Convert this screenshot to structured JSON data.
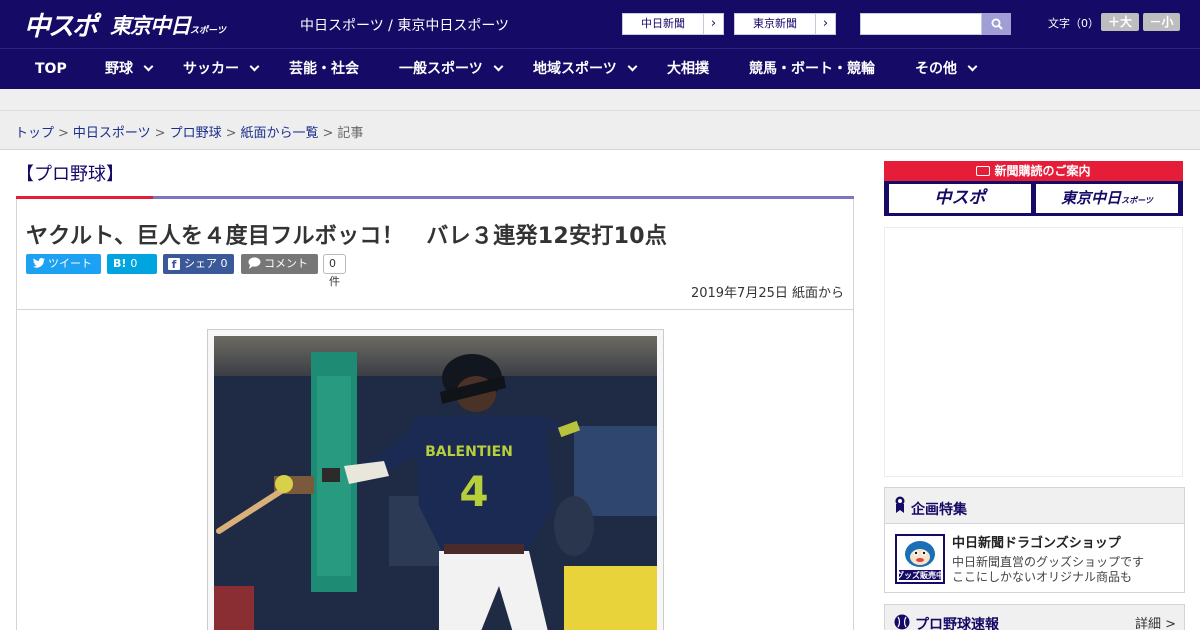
{
  "header": {
    "logo_primary": "中スポ",
    "logo_secondary": "東京中日",
    "logo_secondary_sub": "スポーツ",
    "site_links": "中日スポーツ / 東京中日スポーツ",
    "paper_buttons": [
      {
        "label": "中日新聞",
        "arrow": "›"
      },
      {
        "label": "東京新聞",
        "arrow": "›"
      }
    ],
    "search": {
      "placeholder": "",
      "icon": "search-icon"
    },
    "font_size": {
      "label": "文字（0）",
      "increase": "＋大",
      "decrease": "－小"
    }
  },
  "nav": {
    "items": [
      {
        "label": "TOP",
        "has_dropdown": false
      },
      {
        "label": "野球",
        "has_dropdown": true
      },
      {
        "label": "サッカー",
        "has_dropdown": true
      },
      {
        "label": "芸能・社会",
        "has_dropdown": false
      },
      {
        "label": "一般スポーツ",
        "has_dropdown": true
      },
      {
        "label": "地域スポーツ",
        "has_dropdown": true
      },
      {
        "label": "大相撲",
        "has_dropdown": false
      },
      {
        "label": "競馬・ボート・競輪",
        "has_dropdown": false
      },
      {
        "label": "その他",
        "has_dropdown": true
      }
    ]
  },
  "breadcrumb": {
    "items": [
      "トップ",
      "中日スポーツ",
      "プロ野球",
      "紙面から一覧",
      "記事"
    ],
    "separator": ">"
  },
  "article": {
    "category": "【プロ野球】",
    "headline": "ヤクルト、巨人を４度目フルボッコ！　バレ３連発12安打10点",
    "share": {
      "tweet": "ツイート",
      "hatena": "0",
      "facebook": "シェア 0",
      "comment": "コメント",
      "comment_count": "0件"
    },
    "date": "2019年7月25日 紙面から",
    "photo": {
      "jersey_name": "BALENTIEN",
      "jersey_number": "4"
    }
  },
  "sidebar": {
    "subscribe_title": "新聞購読のご案内",
    "subscribe_buttons": [
      "中スポ",
      "東京中日"
    ],
    "subscribe_button_sub": "スポーツ",
    "feature": {
      "heading": "企画特集",
      "title": "中日新聞ドラゴンズショップ",
      "desc_line1": "中日新聞直営のグッズショップです",
      "desc_line2": "ここにしかないオリジナル商品も",
      "thumb_text": "グッズ販売中"
    },
    "scores": {
      "heading": "プロ野球速報",
      "more": "詳細 >"
    }
  },
  "colors": {
    "brand_navy": "#150a66",
    "accent_red": "#e51d38",
    "twitter": "#1da1f2",
    "hatena": "#00a4de",
    "facebook": "#3b5998",
    "comment": "#777777"
  }
}
